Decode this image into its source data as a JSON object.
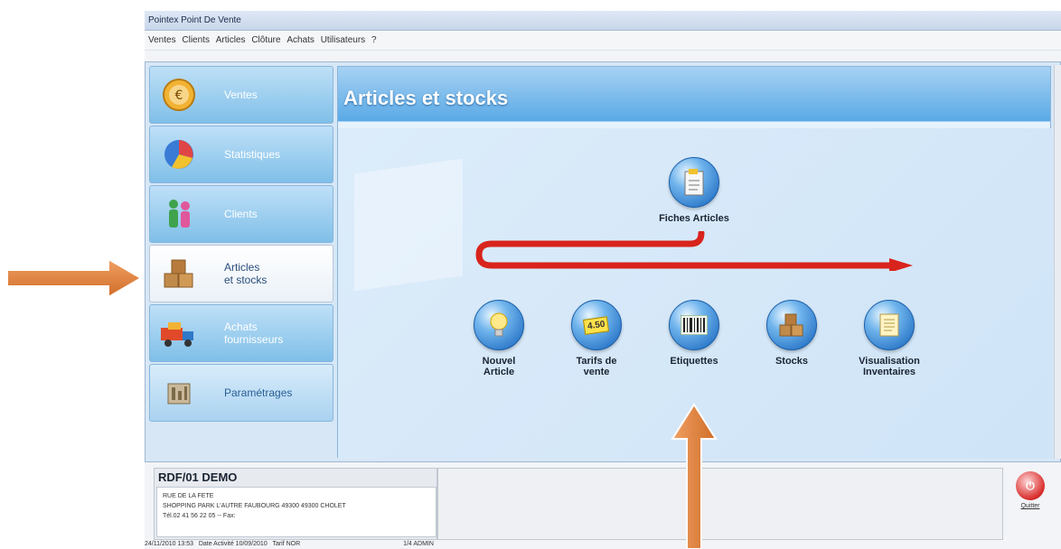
{
  "window": {
    "title": "Pointex Point De Vente"
  },
  "menu": [
    "Ventes",
    "Clients",
    "Articles",
    "Clôture",
    "Achats",
    "Utilisateurs",
    "?"
  ],
  "sidebar": {
    "items": [
      {
        "label_line1": "Ventes",
        "label_line2": "",
        "icon": "euro-coin-icon"
      },
      {
        "label_line1": "Statistiques",
        "label_line2": "",
        "icon": "pie-chart-icon"
      },
      {
        "label_line1": "Clients",
        "label_line2": "",
        "icon": "people-icon"
      },
      {
        "label_line1": "Articles",
        "label_line2": "et stocks",
        "icon": "boxes-icon",
        "active": true
      },
      {
        "label_line1": "Achats",
        "label_line2": "fournisseurs",
        "icon": "truck-icon"
      },
      {
        "label_line1": "Paramétrages",
        "label_line2": "",
        "icon": "settings-icon"
      }
    ]
  },
  "main": {
    "title": "Articles et stocks",
    "actions": [
      {
        "label_line1": "Fiches Articles",
        "label_line2": "",
        "icon": "document-icon"
      },
      {
        "label_line1": "Nouvel",
        "label_line2": "Article",
        "icon": "lightbulb-icon"
      },
      {
        "label_line1": "Tarifs de",
        "label_line2": "vente",
        "icon": "price-tag-icon",
        "badge": "4.50"
      },
      {
        "label_line1": "Etiquettes",
        "label_line2": "",
        "icon": "barcode-icon"
      },
      {
        "label_line1": "Stocks",
        "label_line2": "",
        "icon": "boxes-icon"
      },
      {
        "label_line1": "Visualisation",
        "label_line2": "Inventaires",
        "icon": "scroll-icon"
      }
    ]
  },
  "company": {
    "name": "RDF/01 DEMO",
    "line1": "RUE DE LA FETE",
    "line2": "SHOPPING PARK L'AUTRE FAUBOURG 49300 49300 CHOLET",
    "line3": "Tél.02 41 56 22 05 -- Fax:"
  },
  "quit": {
    "label": "Quitter"
  },
  "status": {
    "datetime": "24/11/2010 13:53",
    "activity": "Date Activité 10/09/2010",
    "tarif": "Tarif NOR",
    "user": "1/4 ADMIN"
  },
  "colors": {
    "accent_arrow": "#e0813f",
    "flow_arrow": "#d8241c",
    "panel_blue": "#5aa9e6"
  }
}
